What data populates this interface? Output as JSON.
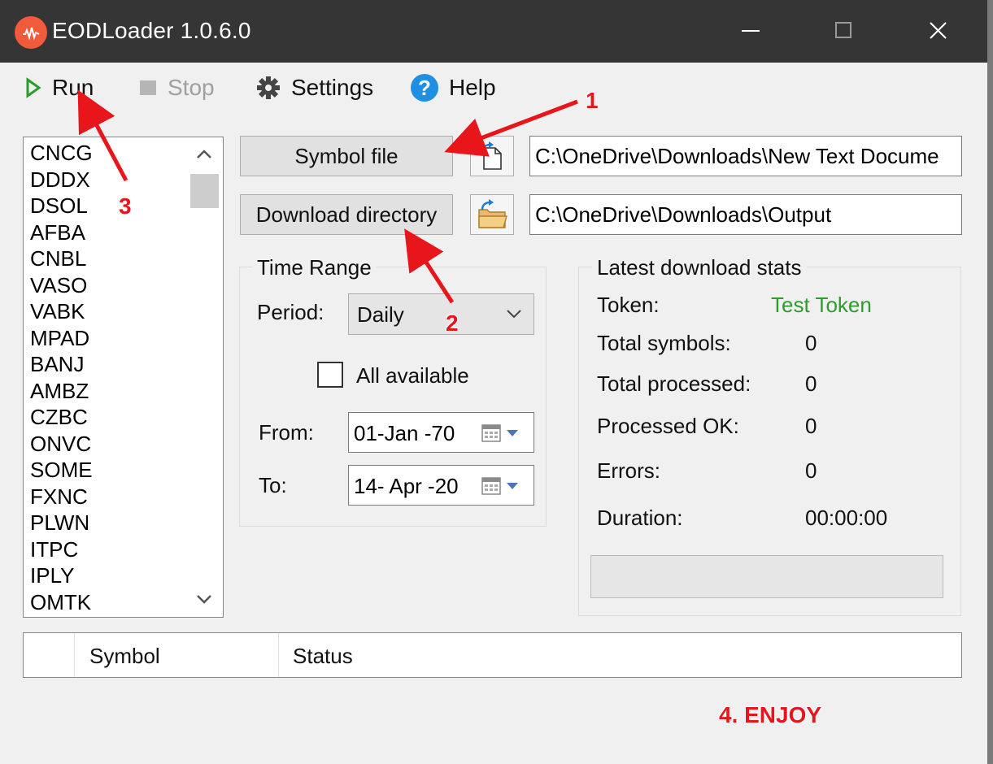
{
  "window": {
    "title": "EODLoader 1.0.6.0",
    "controls": [
      "minimize",
      "maximize",
      "close"
    ]
  },
  "menu": {
    "run": "Run",
    "stop": "Stop",
    "settings": "Settings",
    "help": "Help"
  },
  "symbols": [
    "CNCG",
    "DDDX",
    "DSOL",
    "AFBA",
    "CNBL",
    "VASO",
    "VABK",
    "MPAD",
    "BANJ",
    "AMBZ",
    "CZBC",
    "ONVC",
    "SOME",
    "FXNC",
    "PLWN",
    "ITPC",
    "IPLY",
    "OMTK"
  ],
  "files": {
    "symbol_file_label": "Symbol file",
    "symbol_file_path": "C:\\OneDrive\\Downloads\\New Text Docume",
    "download_dir_label": "Download directory",
    "download_dir_path": "C:\\OneDrive\\Downloads\\Output"
  },
  "time_range": {
    "title": "Time Range",
    "period_label": "Period:",
    "period_value": "Daily",
    "all_available_label": "All available",
    "all_available_checked": false,
    "from_label": "From:",
    "from_value": "01-Jan -70",
    "to_label": "To:",
    "to_value": "14- Apr -20"
  },
  "stats": {
    "title": "Latest download stats",
    "token_label": "Token:",
    "token_value": "Test Token",
    "token_color": "#2e9b2e",
    "total_symbols_label": "Total symbols:",
    "total_symbols": "0",
    "total_processed_label": "Total processed:",
    "total_processed": "0",
    "processed_ok_label": "Processed OK:",
    "processed_ok": "0",
    "errors_label": "Errors:",
    "errors": "0",
    "duration_label": "Duration:",
    "duration": "00:00:00",
    "progress": 0
  },
  "grid": {
    "col_symbol": "Symbol",
    "col_status": "Status"
  },
  "annotations": {
    "a1": "1",
    "a2": "2",
    "a3": "3",
    "a4": "4. ENJOY",
    "color": "#e8151b"
  }
}
